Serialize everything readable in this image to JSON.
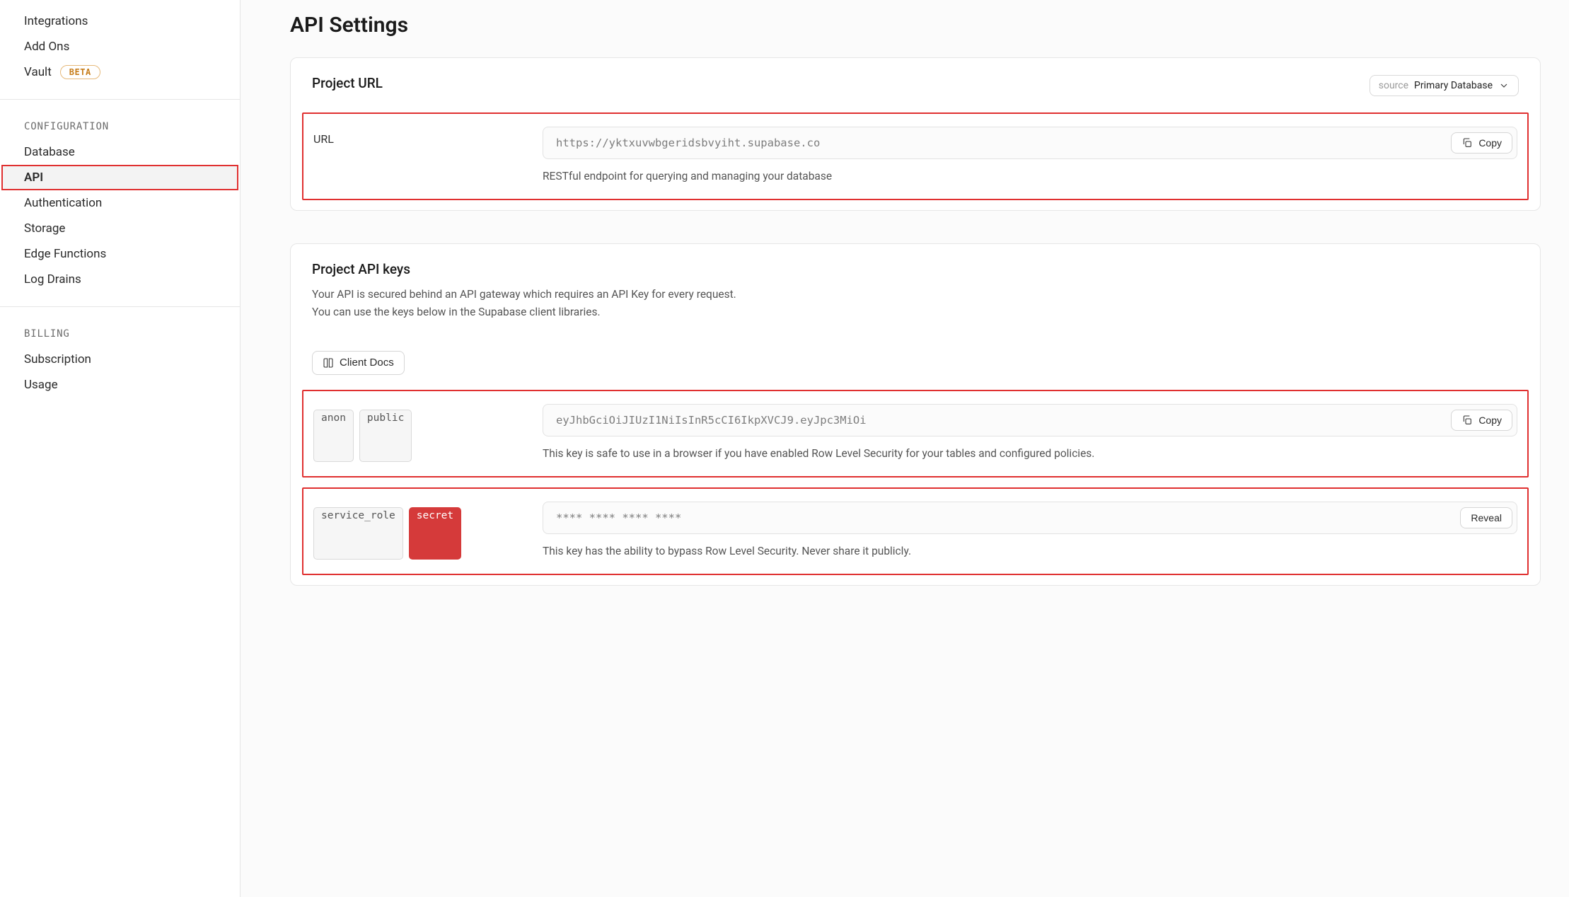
{
  "sidebar": {
    "topItems": [
      {
        "label": "Integrations"
      },
      {
        "label": "Add Ons"
      },
      {
        "label": "Vault",
        "beta": "BETA"
      }
    ],
    "groups": [
      {
        "heading": "CONFIGURATION",
        "items": [
          {
            "label": "Database"
          },
          {
            "label": "API",
            "active": true,
            "highlighted": true
          },
          {
            "label": "Authentication"
          },
          {
            "label": "Storage"
          },
          {
            "label": "Edge Functions"
          },
          {
            "label": "Log Drains"
          }
        ]
      },
      {
        "heading": "BILLING",
        "items": [
          {
            "label": "Subscription"
          },
          {
            "label": "Usage"
          }
        ]
      }
    ]
  },
  "page": {
    "title": "API Settings"
  },
  "project_url": {
    "title": "Project URL",
    "source_label": "source",
    "source_value": "Primary Database",
    "row_label": "URL",
    "value": "https://yktxuvwbgeridsbvyiht.supabase.co",
    "copy": "Copy",
    "hint": "RESTful endpoint for querying and managing your database"
  },
  "api_keys": {
    "title": "Project API keys",
    "desc_line1": "Your API is secured behind an API gateway which requires an API Key for every request.",
    "desc_line2": "You can use the keys below in the Supabase client libraries.",
    "client_docs": "Client Docs",
    "anon": {
      "tag1": "anon",
      "tag2": "public",
      "value": "eyJhbGciOiJIUzI1NiIsInR5cCI6IkpXVCJ9.eyJpc3MiOi",
      "copy": "Copy",
      "hint": "This key is safe to use in a browser if you have enabled Row Level Security for your tables and configured policies."
    },
    "service_role": {
      "tag1": "service_role",
      "tag2": "secret",
      "value": "**** **** **** ****",
      "reveal": "Reveal",
      "hint": "This key has the ability to bypass Row Level Security. Never share it publicly."
    }
  }
}
